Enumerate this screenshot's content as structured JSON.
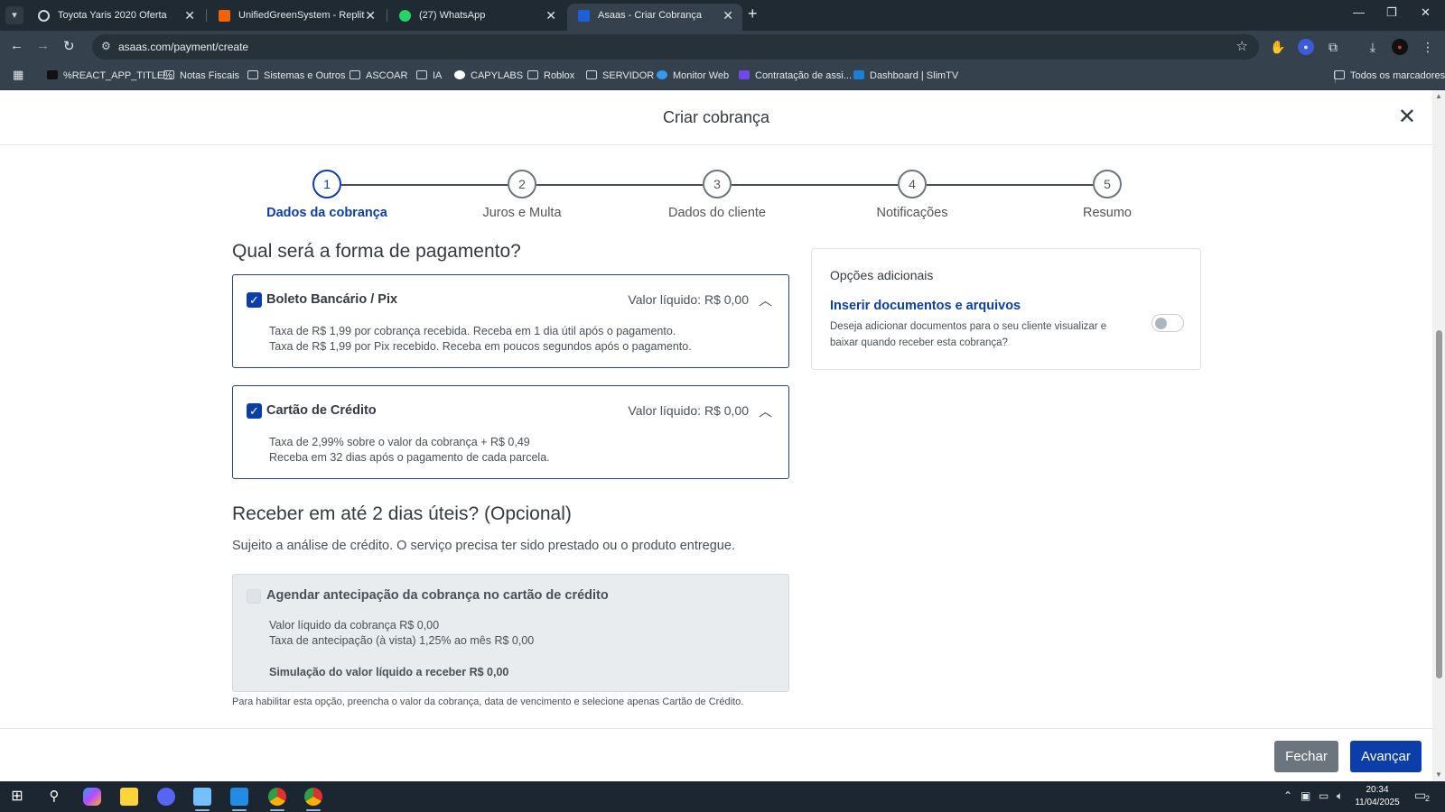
{
  "browser": {
    "tabs": [
      {
        "title": "Toyota Yaris 2020 Oferta",
        "icon": "site-icon"
      },
      {
        "title": "UnifiedGreenSystem - Replit",
        "icon": "replit-icon"
      },
      {
        "title": "(27) WhatsApp",
        "icon": "whatsapp-icon"
      },
      {
        "title": "Asaas - Criar Cobrança",
        "icon": "asaas-icon",
        "active": true
      }
    ],
    "url": "asaas.com/payment/create",
    "bookmarks": [
      "%REACT_APP_TITLE%",
      "Notas Fiscais",
      "Sistemas e Outros",
      "ASCOAR",
      "IA",
      "CAPYLABS",
      "Roblox",
      "SERVIDOR",
      "Monitor Web",
      "Contratação de assi...",
      "Dashboard | SlimTV"
    ],
    "all_bookmarks": "Todos os marcadores"
  },
  "modal": {
    "title": "Criar cobrança",
    "steps": [
      {
        "number": "1",
        "label": "Dados da cobrança",
        "active": true
      },
      {
        "number": "2",
        "label": "Juros e Multa"
      },
      {
        "number": "3",
        "label": "Dados do cliente"
      },
      {
        "number": "4",
        "label": "Notificações"
      },
      {
        "number": "5",
        "label": "Resumo"
      }
    ],
    "payment_heading": "Qual será a forma de pagamento?",
    "methods": [
      {
        "title": "Boleto Bancário / Pix",
        "net_value": "Valor líquido: R$ 0,00",
        "checked": true,
        "lines": [
          "Taxa de R$ 1,99 por cobrança recebida. Receba em 1 dia útil após o pagamento.",
          "Taxa de R$ 1,99 por Pix recebido. Receba em poucos segundos após o pagamento."
        ]
      },
      {
        "title": "Cartão de Crédito",
        "net_value": "Valor líquido: R$ 0,00",
        "checked": true,
        "lines": [
          "Taxa de 2,99% sobre o valor da cobrança + R$ 0,49",
          "Receba em 32 dias após o pagamento de cada parcela."
        ]
      }
    ],
    "anticipation": {
      "heading": "Receber em até 2 dias úteis? (Opcional)",
      "subtext": "Sujeito a análise de crédito. O serviço precisa ter sido prestado ou o produto entregue.",
      "checkbox_label": "Agendar antecipação da cobrança no cartão de crédito",
      "checked": false,
      "line1": "Valor líquido da cobrança R$ 0,00",
      "line2": "Taxa de antecipação (à vista) 1,25% ao mês R$ 0,00",
      "simulation": "Simulação do valor líquido a receber R$ 0,00",
      "footnote": "Para habilitar esta opção, preencha o valor da cobrança, data de vencimento e selecione apenas Cartão de Crédito."
    },
    "additional": {
      "title": "Opções adicionais",
      "link": "Inserir documentos e arquivos",
      "description": "Deseja adicionar documentos para o seu cliente visualizar e baixar quando receber esta cobrança?",
      "toggle_on": false
    },
    "buttons": {
      "close": "Fechar",
      "next": "Avançar"
    }
  },
  "taskbar": {
    "time": "20:34",
    "date": "11/04/2025",
    "notifications": "2"
  },
  "colors": {
    "primary": "#0b3ea8",
    "gray_button": "#6c757d",
    "chrome_bg": "#35424d"
  }
}
